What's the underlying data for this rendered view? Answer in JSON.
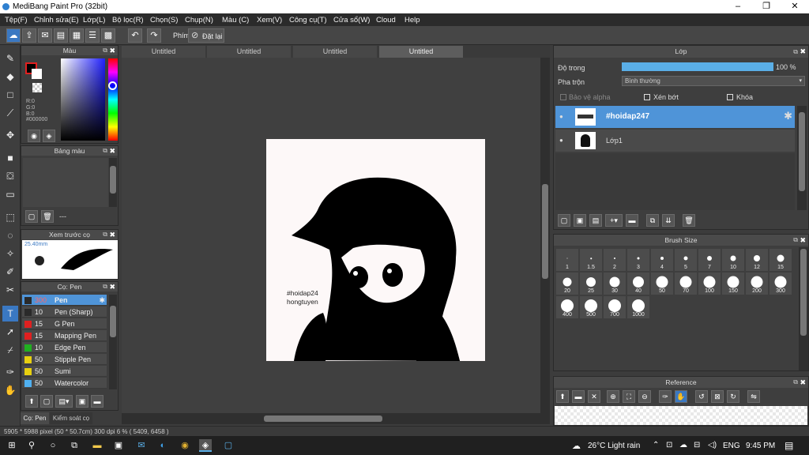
{
  "window": {
    "title": "MediBang Paint Pro (32bit)",
    "min": "–",
    "max": "❐",
    "close": "✕"
  },
  "menu": [
    "Tệp(F)",
    "Chỉnh sửa(E)",
    "Lớp(L)",
    "Bộ lọc(R)",
    "Chọn(S)",
    "Chụp(N)",
    "Màu (C)",
    "Xem(V)",
    "Công cụ(T)",
    "Cửa sổ(W)",
    "Cloud",
    "Help"
  ],
  "toolbar": {
    "phim_label": "Phím",
    "reset_label": "Đặt lại"
  },
  "tabs": [
    "Untitled",
    "Untitled",
    "Untitled",
    "Untitled"
  ],
  "color_panel": {
    "title": "Màu",
    "r": "R:0",
    "g": "G:0",
    "b": "B:0",
    "hex": "#000000"
  },
  "palette_panel": {
    "title": "Bảng màu",
    "dash": "---"
  },
  "preview_panel": {
    "title": "Xem trước cọ",
    "size": "25.40mm"
  },
  "brush_panel": {
    "title": "Cọ: Pen",
    "brushes": [
      {
        "size": "300",
        "name": "Pen",
        "color": "#2a2a2a"
      },
      {
        "size": "10",
        "name": "Pen (Sharp)",
        "color": "#2a2a2a"
      },
      {
        "size": "15",
        "name": "G Pen",
        "color": "#e02020"
      },
      {
        "size": "15",
        "name": "Mapping Pen",
        "color": "#e02020"
      },
      {
        "size": "10",
        "name": "Edge Pen",
        "color": "#20b020"
      },
      {
        "size": "50",
        "name": "Stipple Pen",
        "color": "#e8d010"
      },
      {
        "size": "50",
        "name": "Sumi",
        "color": "#e8d010"
      },
      {
        "size": "50",
        "name": "Watercolor",
        "color": "#50b0f0"
      }
    ],
    "tab_pen": "Cọ: Pen",
    "tab_check": "Kiểm soát cọ"
  },
  "canvas": {
    "watermark_line1": "#hoidap24",
    "watermark_line2": "hongtuyen"
  },
  "layer_panel": {
    "title": "Lớp",
    "opacity_label": "Độ trong",
    "opacity_value": "100 %",
    "opacity": 1.0,
    "blend_label": "Pha trộn",
    "blend_value": "Bình thường",
    "protect_alpha": "Bảo vệ alpha",
    "clipping": "Xén bớt",
    "lock": "Khóa",
    "layers": [
      {
        "name": "#hoidap247",
        "selected": true
      },
      {
        "name": "Lớp1",
        "selected": false
      }
    ]
  },
  "brush_size_panel": {
    "title": "Brush Size",
    "sizes": [
      "1",
      "1.5",
      "2",
      "3",
      "4",
      "5",
      "7",
      "10",
      "12",
      "15",
      "20",
      "25",
      "30",
      "40",
      "50",
      "70",
      "100",
      "150",
      "200",
      "300",
      "400",
      "500",
      "700",
      "1000"
    ]
  },
  "reference_panel": {
    "title": "Reference"
  },
  "status": {
    "text": "5905 * 5988 pixel  (50 * 50.7cm)  300 dpi  6 %  ( 5409, 6458 )"
  },
  "taskbar": {
    "weather": "26°C  Light rain",
    "lang": "ENG",
    "time": "9:45 PM"
  }
}
